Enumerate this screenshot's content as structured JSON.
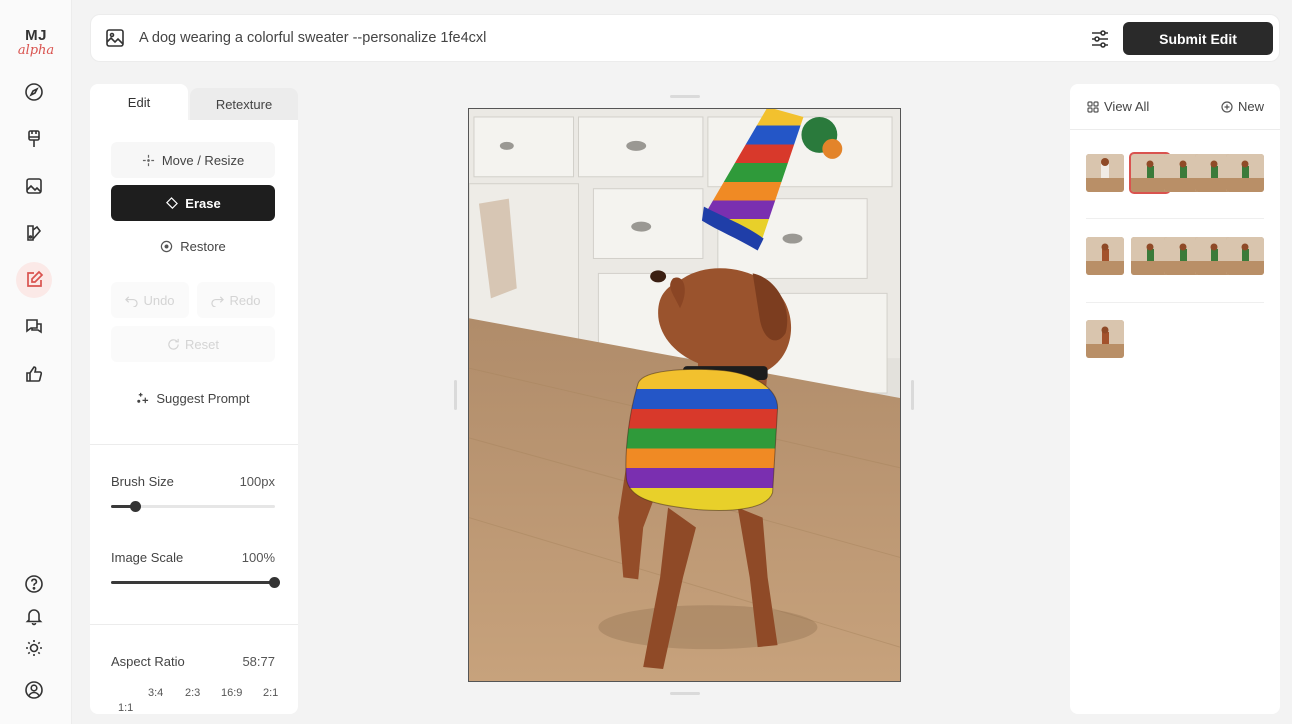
{
  "app": {
    "logo_primary": "MJ",
    "logo_secondary": "alpha"
  },
  "nav": {
    "items": [
      {
        "icon": "compass-icon"
      },
      {
        "icon": "brush-icon"
      },
      {
        "icon": "image-icon"
      },
      {
        "icon": "palette-icon"
      },
      {
        "icon": "edit-icon",
        "active": true
      },
      {
        "icon": "chat-icon"
      },
      {
        "icon": "thumbs-up-icon"
      }
    ],
    "bottom": [
      {
        "icon": "help-icon"
      },
      {
        "icon": "bell-icon"
      },
      {
        "icon": "sun-icon"
      },
      {
        "icon": "user-icon"
      }
    ]
  },
  "topbar": {
    "prompt": "A dog wearing a colorful sweater --personalize 1fe4cxl",
    "submit_label": "Submit Edit"
  },
  "editor": {
    "tabs": [
      {
        "label": "Edit",
        "active": true
      },
      {
        "label": "Retexture",
        "active": false
      }
    ],
    "tools": {
      "move_resize": "Move / Resize",
      "erase": "Erase",
      "restore": "Restore",
      "undo": "Undo",
      "redo": "Redo",
      "reset": "Reset",
      "suggest_prompt": "Suggest Prompt"
    },
    "brush_size": {
      "label": "Brush Size",
      "value": "100px",
      "level": 0.15
    },
    "image_scale": {
      "label": "Image Scale",
      "value": "100%",
      "level": 1.0
    },
    "aspect_ratio": {
      "label": "Aspect Ratio",
      "value": "58:77",
      "options": [
        "3:4",
        "2:3",
        "16:9",
        "2:1",
        "1:1"
      ]
    }
  },
  "gallery": {
    "view_all_label": "View All",
    "new_label": "New"
  },
  "colors": {
    "accent": "#d9534f",
    "dark_button": "#1e1e1e"
  }
}
